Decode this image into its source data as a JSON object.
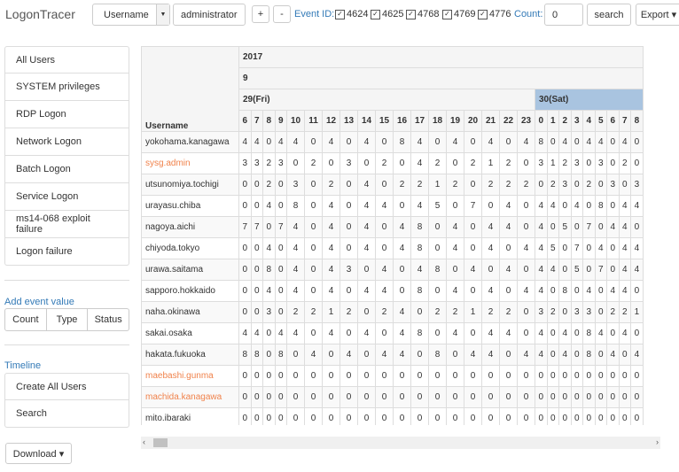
{
  "header": {
    "brand": "LogonTracer",
    "search_type": "Username",
    "search_value": "administrator",
    "plus_label": "+",
    "minus_label": "-",
    "event_id_label": "Event ID:",
    "event_ids": [
      "4624",
      "4625",
      "4768",
      "4769",
      "4776"
    ],
    "checked_mark": "☑",
    "count_label": "Count:",
    "count_value": "0",
    "search_label": "search",
    "export_label": "Export ▾"
  },
  "sidebar": {
    "menu": [
      "All Users",
      "SYSTEM privileges",
      "RDP Logon",
      "Network Logon",
      "Batch Logon",
      "Service Logon",
      "ms14-068 exploit failure",
      "Logon failure"
    ],
    "add_event_title": "Add event value",
    "event_buttons": [
      "Count",
      "Type",
      "Status"
    ],
    "timeline_title": "Timeline",
    "timeline_items": [
      "Create All Users",
      "Search"
    ],
    "download_label": "Download ▾"
  },
  "table": {
    "year": "2017",
    "month": "9",
    "days": [
      "29(Fri)",
      "30(Sat)"
    ],
    "user_header": "Username",
    "hours": [
      "6",
      "7",
      "8",
      "9",
      "10",
      "11",
      "12",
      "13",
      "14",
      "15",
      "16",
      "17",
      "18",
      "19",
      "20",
      "21",
      "22",
      "23",
      "0",
      "1",
      "2",
      "3",
      "4",
      "5",
      "6",
      "7",
      "8"
    ],
    "rows": [
      {
        "name": "yokohama.kanagawa",
        "highlight": false,
        "values": [
          "4",
          "4",
          "0",
          "4",
          "4",
          "0",
          "4",
          "0",
          "4",
          "0",
          "8",
          "4",
          "0",
          "4",
          "0",
          "4",
          "0",
          "4",
          "8",
          "0",
          "4",
          "0",
          "4",
          "4",
          "0",
          "4",
          "0"
        ]
      },
      {
        "name": "sysg.admin",
        "highlight": true,
        "values": [
          "3",
          "3",
          "2",
          "3",
          "0",
          "2",
          "0",
          "3",
          "0",
          "2",
          "0",
          "4",
          "2",
          "0",
          "2",
          "1",
          "2",
          "0",
          "3",
          "1",
          "2",
          "3",
          "0",
          "3",
          "0",
          "2",
          "0"
        ]
      },
      {
        "name": "utsunomiya.tochigi",
        "highlight": false,
        "values": [
          "0",
          "0",
          "2",
          "0",
          "3",
          "0",
          "2",
          "0",
          "4",
          "0",
          "2",
          "2",
          "1",
          "2",
          "0",
          "2",
          "2",
          "2",
          "0",
          "2",
          "3",
          "0",
          "2",
          "0",
          "3",
          "0",
          "3"
        ]
      },
      {
        "name": "urayasu.chiba",
        "highlight": false,
        "values": [
          "0",
          "0",
          "4",
          "0",
          "8",
          "0",
          "4",
          "0",
          "4",
          "4",
          "0",
          "4",
          "5",
          "0",
          "7",
          "0",
          "4",
          "0",
          "4",
          "4",
          "0",
          "4",
          "0",
          "8",
          "0",
          "4",
          "4"
        ]
      },
      {
        "name": "nagoya.aichi",
        "highlight": false,
        "values": [
          "7",
          "7",
          "0",
          "7",
          "4",
          "0",
          "4",
          "0",
          "4",
          "0",
          "4",
          "8",
          "0",
          "4",
          "0",
          "4",
          "4",
          "0",
          "4",
          "0",
          "5",
          "0",
          "7",
          "0",
          "4",
          "4",
          "0"
        ]
      },
      {
        "name": "chiyoda.tokyo",
        "highlight": false,
        "values": [
          "0",
          "0",
          "4",
          "0",
          "4",
          "0",
          "4",
          "0",
          "4",
          "0",
          "4",
          "8",
          "0",
          "4",
          "0",
          "4",
          "0",
          "4",
          "4",
          "5",
          "0",
          "7",
          "0",
          "4",
          "0",
          "4",
          "4"
        ]
      },
      {
        "name": "urawa.saitama",
        "highlight": false,
        "values": [
          "0",
          "0",
          "8",
          "0",
          "4",
          "0",
          "4",
          "3",
          "0",
          "4",
          "0",
          "4",
          "8",
          "0",
          "4",
          "0",
          "4",
          "0",
          "4",
          "4",
          "0",
          "5",
          "0",
          "7",
          "0",
          "4",
          "4"
        ]
      },
      {
        "name": "sapporo.hokkaido",
        "highlight": false,
        "values": [
          "0",
          "0",
          "4",
          "0",
          "4",
          "0",
          "4",
          "0",
          "4",
          "4",
          "0",
          "8",
          "0",
          "4",
          "0",
          "4",
          "0",
          "4",
          "4",
          "0",
          "8",
          "0",
          "4",
          "0",
          "4",
          "4",
          "0"
        ]
      },
      {
        "name": "naha.okinawa",
        "highlight": false,
        "values": [
          "0",
          "0",
          "3",
          "0",
          "2",
          "2",
          "1",
          "2",
          "0",
          "2",
          "4",
          "0",
          "2",
          "2",
          "1",
          "2",
          "2",
          "0",
          "3",
          "2",
          "0",
          "3",
          "3",
          "0",
          "2",
          "2",
          "1"
        ]
      },
      {
        "name": "sakai.osaka",
        "highlight": false,
        "values": [
          "4",
          "4",
          "0",
          "4",
          "4",
          "0",
          "4",
          "0",
          "4",
          "0",
          "4",
          "8",
          "0",
          "4",
          "0",
          "4",
          "4",
          "0",
          "4",
          "0",
          "4",
          "0",
          "8",
          "4",
          "0",
          "4",
          "0"
        ]
      },
      {
        "name": "hakata.fukuoka",
        "highlight": false,
        "values": [
          "8",
          "8",
          "0",
          "8",
          "0",
          "4",
          "0",
          "4",
          "0",
          "4",
          "4",
          "0",
          "8",
          "0",
          "4",
          "4",
          "0",
          "4",
          "4",
          "0",
          "4",
          "0",
          "8",
          "0",
          "4",
          "0",
          "4"
        ]
      },
      {
        "name": "maebashi.gunma",
        "highlight": true,
        "values": [
          "0",
          "0",
          "0",
          "0",
          "0",
          "0",
          "0",
          "0",
          "0",
          "0",
          "0",
          "0",
          "0",
          "0",
          "0",
          "0",
          "0",
          "0",
          "0",
          "0",
          "0",
          "0",
          "0",
          "0",
          "0",
          "0",
          "0"
        ]
      },
      {
        "name": "machida.kanagawa",
        "highlight": true,
        "values": [
          "0",
          "0",
          "0",
          "0",
          "0",
          "0",
          "0",
          "0",
          "0",
          "0",
          "0",
          "0",
          "0",
          "0",
          "0",
          "0",
          "0",
          "0",
          "0",
          "0",
          "0",
          "0",
          "0",
          "0",
          "0",
          "0",
          "0"
        ]
      },
      {
        "name": "mito.ibaraki",
        "highlight": false,
        "values": [
          "0",
          "0",
          "0",
          "0",
          "0",
          "0",
          "0",
          "0",
          "0",
          "0",
          "0",
          "0",
          "0",
          "0",
          "0",
          "0",
          "0",
          "0",
          "0",
          "0",
          "0",
          "0",
          "0",
          "0",
          "0",
          "0",
          "0"
        ]
      }
    ]
  },
  "scrollbar": {
    "left_arrow": "‹",
    "right_arrow": "›"
  }
}
